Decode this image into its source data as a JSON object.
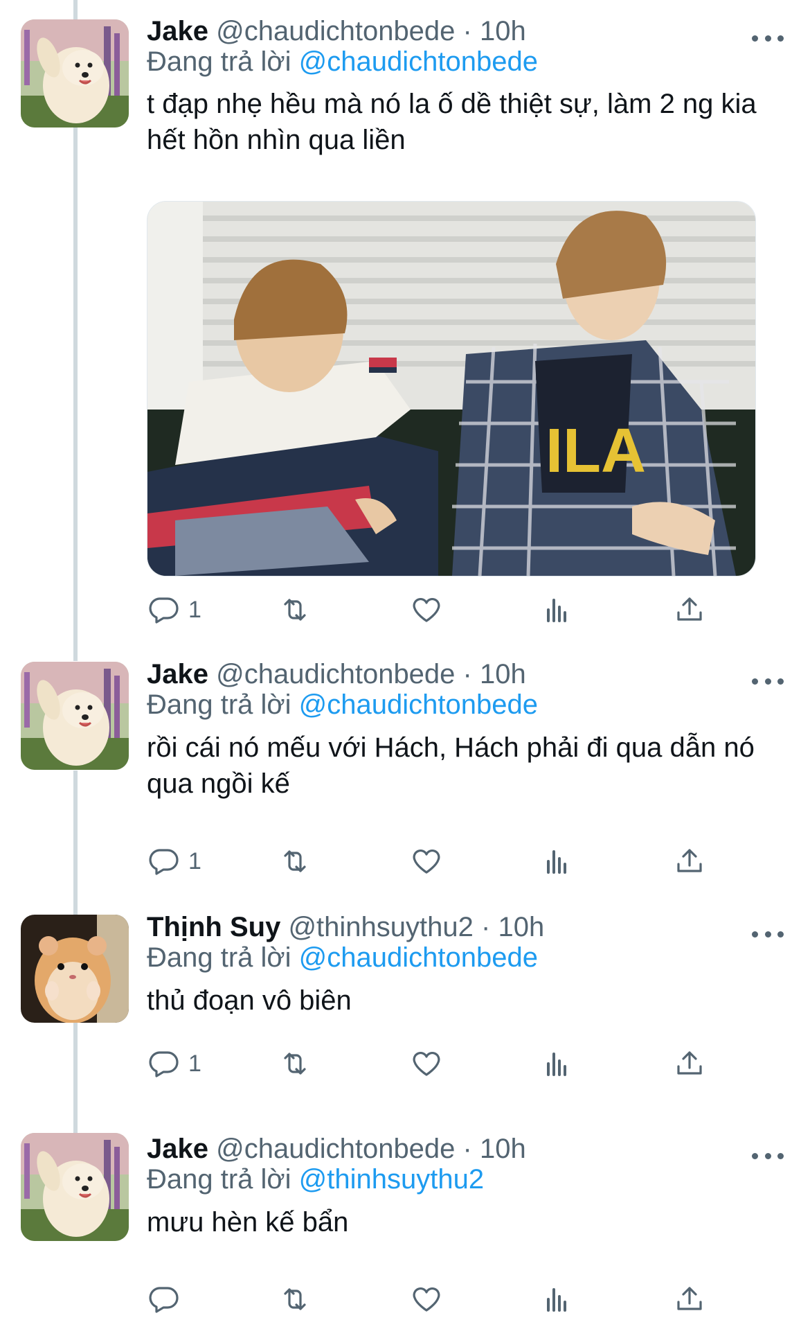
{
  "tweets": [
    {
      "name": "Jake",
      "handle": "@chaudichtonbede",
      "dot": "·",
      "time": "10h",
      "replying_label": "Đang trả lời",
      "replying_to": "@chaudichtonbede",
      "text": "t đạp nhẹ hều mà nó la ố dề thiệt sự, làm 2 ng kia hết hồn nhìn qua liền",
      "reply_count": "1",
      "avatar": "samoyed-dog-avatar"
    },
    {
      "name": "Jake",
      "handle": "@chaudichtonbede",
      "dot": "·",
      "time": "10h",
      "replying_label": "Đang trả lời",
      "replying_to": "@chaudichtonbede",
      "text": "rồi cái nó mếu với Hách, Hách phải đi qua dẫn nó qua ngồi kế",
      "reply_count": "1",
      "avatar": "samoyed-dog-avatar"
    },
    {
      "name": "Thịnh Suy",
      "handle": "@thinhsuythu2",
      "dot": "·",
      "time": "10h",
      "replying_label": "Đang trả lời",
      "replying_to": "@chaudichtonbede",
      "text": "thủ đoạn vô biên",
      "reply_count": "1",
      "avatar": "hamster-avatar"
    },
    {
      "name": "Jake",
      "handle": "@chaudichtonbede",
      "dot": "·",
      "time": "10h",
      "replying_label": "Đang trả lời",
      "replying_to": "@thinhsuythu2",
      "text": "mưu hèn kế bẩn",
      "reply_count": "",
      "avatar": "samoyed-dog-avatar"
    }
  ],
  "colors": {
    "text": "#0f1419",
    "secondary": "#536471",
    "link": "#1d9bf0",
    "thread_line": "#cfd9de"
  },
  "icons": [
    "reply-icon",
    "retweet-icon",
    "like-icon",
    "views-icon",
    "share-icon",
    "more-icon"
  ]
}
